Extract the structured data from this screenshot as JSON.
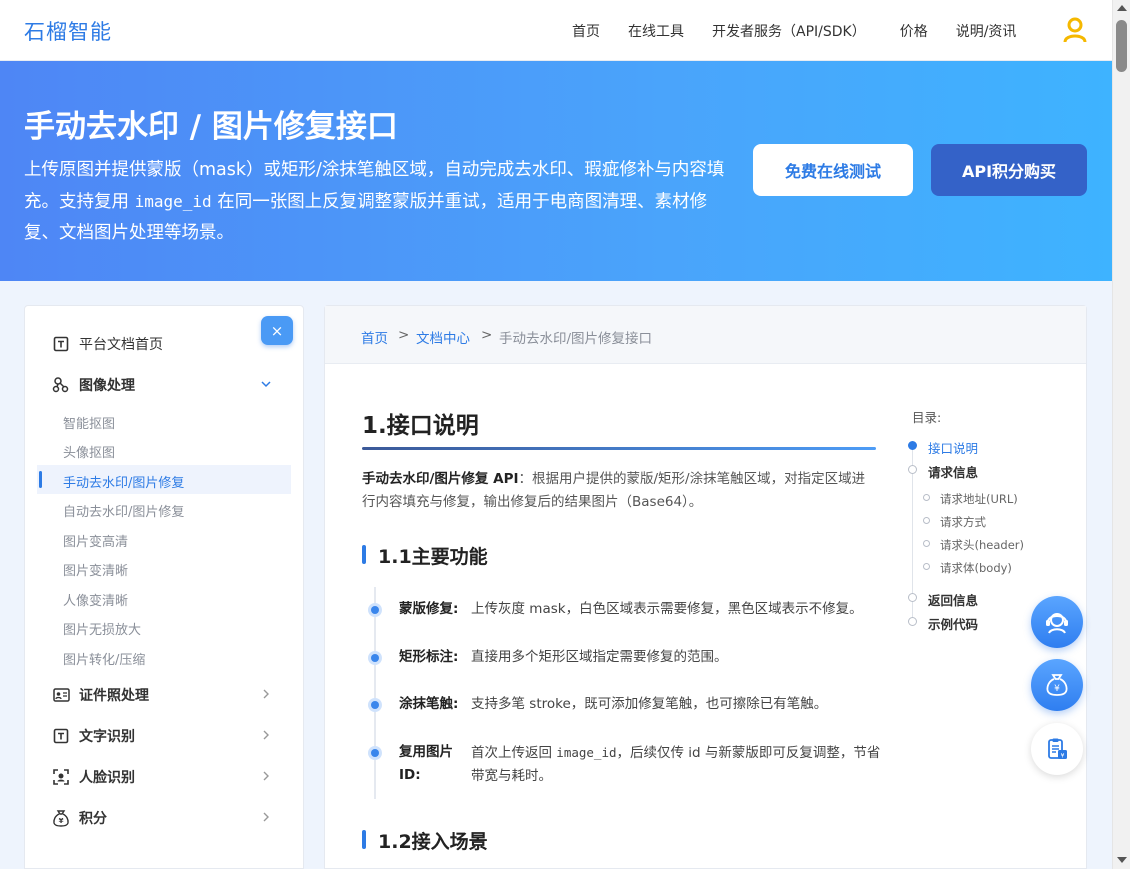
{
  "header": {
    "logo": "石榴智能",
    "nav": [
      "首页",
      "在线工具",
      "开发者服务（API/SDK）",
      "价格",
      "说明/资讯"
    ]
  },
  "hero": {
    "title": "手动去水印 / 图片修复接口",
    "desc_part1": "上传原图并提供蒙版（mask）或矩形/涂抹笔触区域，自动完成去水印、瑕疵修补与内容填充。支持复用 ",
    "desc_code": "image_id",
    "desc_part2": " 在同一张图上反复调整蒙版并重试，适用于电商图清理、素材修复、文档图片处理等场景。",
    "btn_test": "免费在线测试",
    "btn_buy": "API积分购买"
  },
  "sidebar": {
    "close": "×",
    "home": "平台文档首页",
    "image_processing": "图像处理",
    "sub_items": [
      "智能抠图",
      "头像抠图",
      "手动去水印/图片修复",
      "自动去水印/图片修复",
      "图片变高清",
      "图片变清晰",
      "人像变清晰",
      "图片无损放大",
      "图片转化/压缩"
    ],
    "id_photo": "证件照处理",
    "ocr": "文字识别",
    "face": "人脸识别",
    "points": "积分"
  },
  "breadcrumb": {
    "home": "首页",
    "sep": ">",
    "docs": "文档中心",
    "current": "手动去水印/图片修复接口"
  },
  "content": {
    "h1": "1.接口说明",
    "intro_bold": "手动去水印/图片修复 API",
    "intro_text": "：根据用户提供的蒙版/矩形/涂抹笔触区域，对指定区域进行内容填充与修复，输出修复后的结果图片（Base64）。",
    "h2_features": "1.1主要功能",
    "features": [
      {
        "label": "蒙版修复:",
        "text": "上传灰度 mask，白色区域表示需要修复，黑色区域表示不修复。"
      },
      {
        "label": "矩形标注:",
        "text": "直接用多个矩形区域指定需要修复的范围。"
      },
      {
        "label": "涂抹笔触:",
        "text": "支持多笔 stroke，既可添加修复笔触，也可擦除已有笔触。"
      },
      {
        "label1": "复用图片",
        "label2": "ID:",
        "text_a": "首次上传返回 ",
        "text_code": "image_id",
        "text_b": "，后续仅传 id 与新蒙版即可反复调整，节省带宽与耗时。"
      }
    ],
    "h2_scenes": "1.2接入场景"
  },
  "toc": {
    "title": "目录:",
    "items": [
      "接口说明",
      "请求信息",
      "请求地址(URL)",
      "请求方式",
      "请求头(header)",
      "请求体(body)",
      "返回信息",
      "示例代码"
    ]
  },
  "colors": {
    "brand": "#2d7be5",
    "hero_start": "#4e86f5",
    "hero_end": "#3eb3ff",
    "buy_button": "#3462c8",
    "user_icon": "#f5b800"
  }
}
